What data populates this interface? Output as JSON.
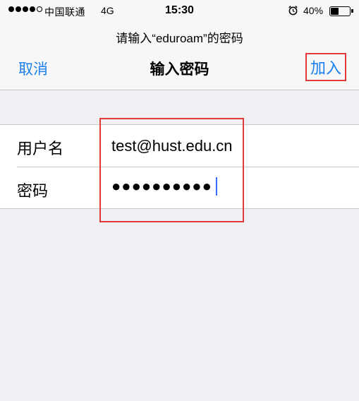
{
  "status_bar": {
    "carrier": "中国联通",
    "network": "4G",
    "time": "15:30",
    "battery_percent": "40%",
    "battery_level": 0.4,
    "signal_bars": 4,
    "signal_max": 5
  },
  "dialog": {
    "prompt": "请输入“eduroam”的密码",
    "title": "输入密码",
    "cancel_label": "取消",
    "join_label": "加入"
  },
  "form": {
    "username_label": "用户名",
    "username_value": "test@hust.edu.cn",
    "password_label": "密码",
    "password_masked": "●●●●●●●●●●"
  },
  "colors": {
    "accent": "#1a7ff0",
    "highlight": "#e03a3a",
    "cursor": "#3b6bff"
  }
}
